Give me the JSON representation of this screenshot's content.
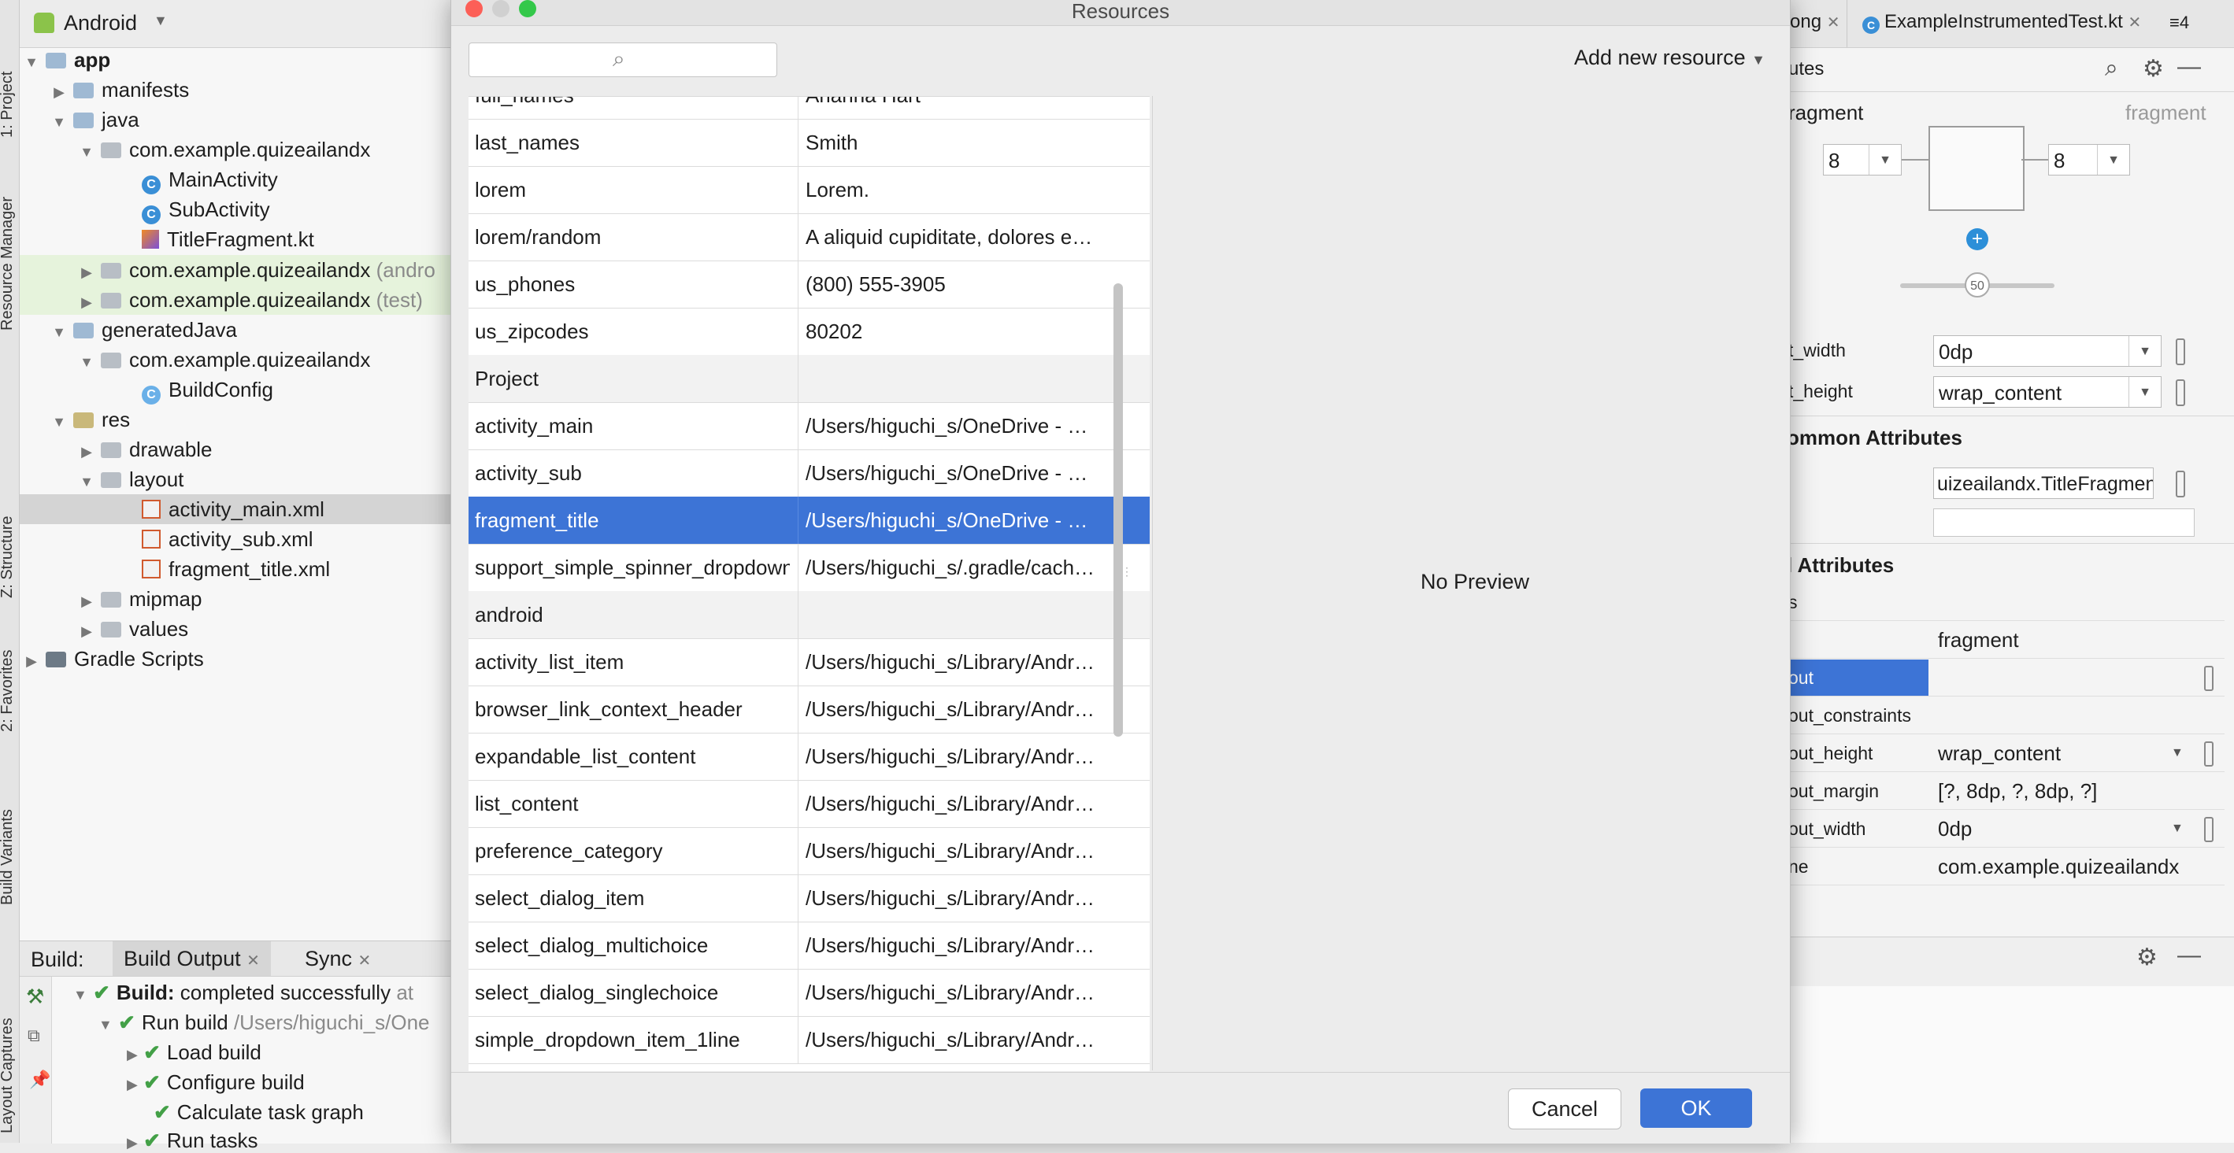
{
  "left_stripe": {
    "labels": [
      "1: Project",
      "Resource Manager",
      "Z: Structure",
      "2: Favorites",
      "Build Variants",
      "Layout Captures"
    ]
  },
  "project_panel": {
    "view_selector": "Android",
    "tree": [
      {
        "label": "app",
        "note": ""
      },
      {
        "label": "manifests",
        "note": ""
      },
      {
        "label": "java",
        "note": ""
      },
      {
        "label": "com.example.quizeailandx",
        "note": ""
      },
      {
        "label": "MainActivity",
        "note": ""
      },
      {
        "label": "SubActivity",
        "note": ""
      },
      {
        "label": "TitleFragment.kt",
        "note": ""
      },
      {
        "label": "com.example.quizeailandx",
        "note": "(andro"
      },
      {
        "label": "com.example.quizeailandx",
        "note": "(test)"
      },
      {
        "label": "generatedJava",
        "note": ""
      },
      {
        "label": "com.example.quizeailandx",
        "note": ""
      },
      {
        "label": "BuildConfig",
        "note": ""
      },
      {
        "label": "res",
        "note": ""
      },
      {
        "label": "drawable",
        "note": ""
      },
      {
        "label": "layout",
        "note": ""
      },
      {
        "label": "activity_main.xml",
        "note": ""
      },
      {
        "label": "activity_sub.xml",
        "note": ""
      },
      {
        "label": "fragment_title.xml",
        "note": ""
      },
      {
        "label": "mipmap",
        "note": ""
      },
      {
        "label": "values",
        "note": ""
      },
      {
        "label": "Gradle Scripts",
        "note": ""
      }
    ]
  },
  "build_panel": {
    "label": "Build:",
    "tabs": [
      "Build Output",
      "Sync"
    ],
    "status_bold": "Build:",
    "status_text": "completed successfully",
    "status_suffix": "at",
    "run_build": "Run build",
    "run_build_path": "/Users/higuchi_s/One",
    "steps": [
      "Load build",
      "Configure build",
      "Calculate task graph",
      "Run tasks"
    ]
  },
  "editor_tabs": [
    "ong",
    "ExampleInstrumentedTest.kt",
    "≡4"
  ],
  "attributes_panel": {
    "title": "utes",
    "component": "ragment",
    "component_type": "fragment",
    "margin_left": "8",
    "margin_right": "8",
    "bias": "50",
    "layout_width_label": "t_width",
    "layout_width_value": "0dp",
    "layout_height_label": "t_height",
    "layout_height_value": "wrap_content",
    "common_header": "ommon Attributes",
    "name_value": "uizeailandx.TitleFragment",
    "all_header": "l Attributes",
    "rows": [
      {
        "label": "s",
        "value": ""
      },
      {
        "label": "",
        "value": "fragment"
      },
      {
        "label": "out",
        "value": ""
      },
      {
        "label": "out_constraints",
        "value": ""
      },
      {
        "label": "out_height",
        "value": "wrap_content"
      },
      {
        "label": "out_margin",
        "value": "[?, 8dp, ?, 8dp, ?]"
      },
      {
        "label": "out_width",
        "value": "0dp"
      },
      {
        "label": "ne",
        "value": "com.example.quizeailandx"
      }
    ]
  },
  "dialog": {
    "title": "Resources",
    "search_placeholder": "",
    "add_new_resource": "Add new resource",
    "preview_text": "No Preview",
    "cancel_label": "Cancel",
    "ok_label": "OK",
    "rows": [
      {
        "name": "full_names",
        "value": "Arianna Hart",
        "group": false,
        "selected": false
      },
      {
        "name": "last_names",
        "value": "Smith",
        "group": false,
        "selected": false
      },
      {
        "name": "lorem",
        "value": "Lorem.",
        "group": false,
        "selected": false
      },
      {
        "name": "lorem/random",
        "value": "A aliquid cupiditate, dolores e…",
        "group": false,
        "selected": false
      },
      {
        "name": "us_phones",
        "value": "(800) 555-3905",
        "group": false,
        "selected": false
      },
      {
        "name": "us_zipcodes",
        "value": "80202",
        "group": false,
        "selected": false
      },
      {
        "name": "Project",
        "value": "",
        "group": true,
        "selected": false
      },
      {
        "name": "activity_main",
        "value": "/Users/higuchi_s/OneDrive - …",
        "group": false,
        "selected": false
      },
      {
        "name": "activity_sub",
        "value": "/Users/higuchi_s/OneDrive - …",
        "group": false,
        "selected": false
      },
      {
        "name": "fragment_title",
        "value": "/Users/higuchi_s/OneDrive - …",
        "group": false,
        "selected": true
      },
      {
        "name": "support_simple_spinner_dropdown",
        "value": "/Users/higuchi_s/.gradle/cach…",
        "group": false,
        "selected": false
      },
      {
        "name": "android",
        "value": "",
        "group": true,
        "selected": false
      },
      {
        "name": "activity_list_item",
        "value": "/Users/higuchi_s/Library/Andr…",
        "group": false,
        "selected": false
      },
      {
        "name": "browser_link_context_header",
        "value": "/Users/higuchi_s/Library/Andr…",
        "group": false,
        "selected": false
      },
      {
        "name": "expandable_list_content",
        "value": "/Users/higuchi_s/Library/Andr…",
        "group": false,
        "selected": false
      },
      {
        "name": "list_content",
        "value": "/Users/higuchi_s/Library/Andr…",
        "group": false,
        "selected": false
      },
      {
        "name": "preference_category",
        "value": "/Users/higuchi_s/Library/Andr…",
        "group": false,
        "selected": false
      },
      {
        "name": "select_dialog_item",
        "value": "/Users/higuchi_s/Library/Andr…",
        "group": false,
        "selected": false
      },
      {
        "name": "select_dialog_multichoice",
        "value": "/Users/higuchi_s/Library/Andr…",
        "group": false,
        "selected": false
      },
      {
        "name": "select_dialog_singlechoice",
        "value": "/Users/higuchi_s/Library/Andr…",
        "group": false,
        "selected": false
      },
      {
        "name": "simple_dropdown_item_1line",
        "value": "/Users/higuchi_s/Library/Andr…",
        "group": false,
        "selected": false
      }
    ]
  },
  "colors": {
    "selection": "#3d74d6",
    "ok_button": "#3d74d6",
    "success_check": "#43a047"
  }
}
